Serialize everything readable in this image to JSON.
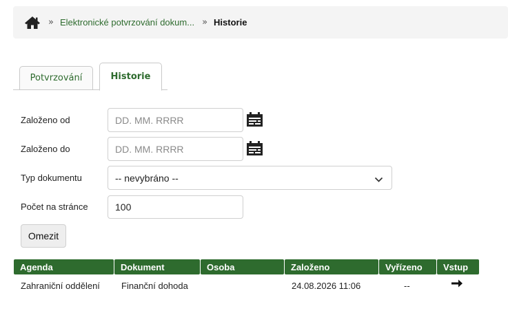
{
  "breadcrumb": {
    "home_icon": "home-icon",
    "separator": "»",
    "link": "Elektronické potvrzování dokum...",
    "current": "Historie"
  },
  "tabs": [
    {
      "label": "Potvrzování",
      "active": false
    },
    {
      "label": "Historie",
      "active": true
    }
  ],
  "filters": {
    "from_label": "Založeno od",
    "from_placeholder": "DD. MM. RRRR",
    "to_label": "Založeno do",
    "to_placeholder": "DD. MM. RRRR",
    "type_label": "Typ dokumentu",
    "type_selected": "-- nevybráno --",
    "page_size_label": "Počet na stránce",
    "page_size_value": "100",
    "submit_label": "Omezit"
  },
  "table": {
    "headers": [
      "Agenda",
      "Dokument",
      "Osoba",
      "Založeno",
      "Vyřízeno",
      "Vstup"
    ],
    "rows": [
      {
        "agenda": "Zahraniční oddělení",
        "dokument": "Finanční dohoda",
        "osoba": "",
        "zalozeno": "24.08.2026 11:06",
        "vyrizeno": "--",
        "vstup_icon": "arrow-right-icon"
      }
    ]
  },
  "colors": {
    "accent": "#2e6b2e",
    "breadcrumb_bg": "#f4f4f4"
  }
}
